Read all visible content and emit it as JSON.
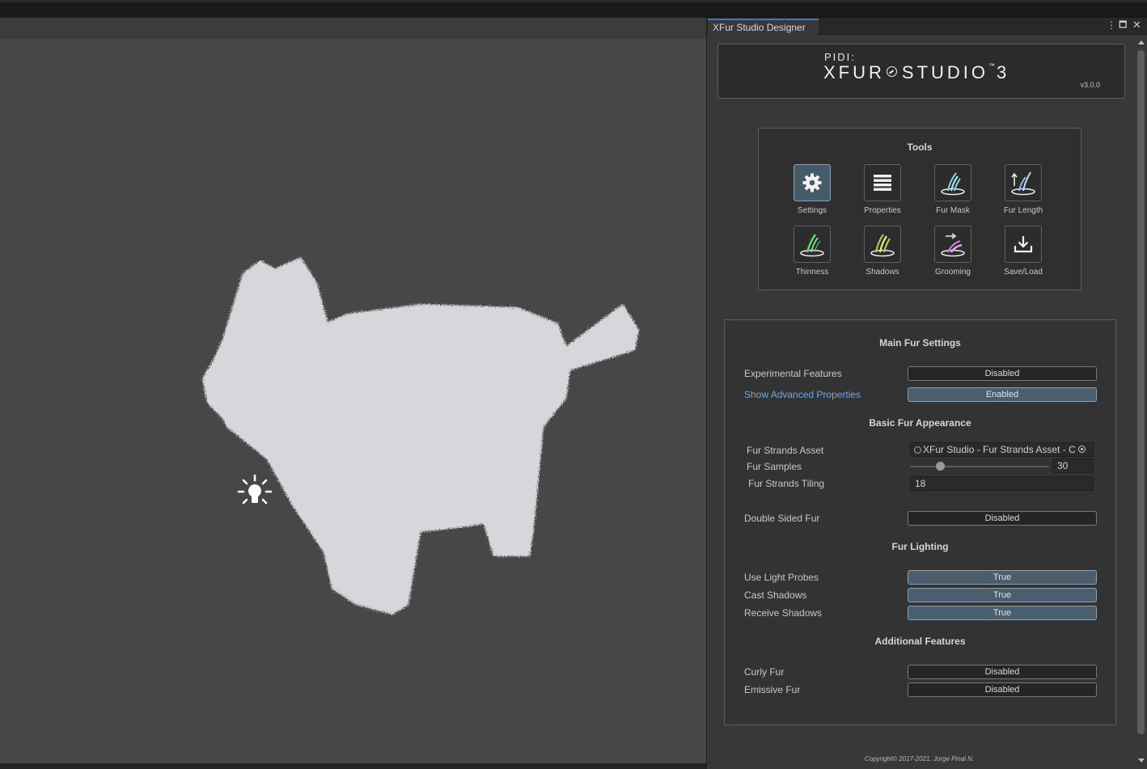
{
  "window": {
    "tab_title": "XFur Studio Designer",
    "menu_icon": "kebab-menu-icon",
    "maximize_icon": "maximize-icon",
    "close_icon": "close-icon"
  },
  "brand": {
    "company": "PIDI:",
    "product_part1": "XFUR",
    "product_part2": "STUDIO",
    "trademark": "™",
    "product_version_number": "3",
    "version": "v3.0.0"
  },
  "tools": {
    "title": "Tools",
    "items": [
      {
        "label": "Settings",
        "icon": "gear-icon",
        "active": true
      },
      {
        "label": "Properties",
        "icon": "list-icon",
        "active": false
      },
      {
        "label": "Fur Mask",
        "icon": "fur-mask-icon",
        "active": false
      },
      {
        "label": "Fur Length",
        "icon": "fur-length-icon",
        "active": false
      },
      {
        "label": "Thinness",
        "icon": "thinness-icon",
        "active": false
      },
      {
        "label": "Shadows",
        "icon": "shadows-icon",
        "active": false
      },
      {
        "label": "Grooming",
        "icon": "grooming-icon",
        "active": false
      },
      {
        "label": "Save/Load",
        "icon": "download-icon",
        "active": false
      }
    ]
  },
  "main": {
    "title": "Main Fur Settings",
    "experimental_label": "Experimental Features",
    "experimental_value": "Disabled",
    "advanced_label": "Show Advanced Properties",
    "advanced_value": "Enabled",
    "basic_title": "Basic Fur Appearance",
    "strands_asset_label": "Fur Strands Asset",
    "strands_asset_value": "XFur Studio - Fur Strands Asset - C",
    "samples_label": "Fur Samples",
    "samples_value": "30",
    "samples_fraction": 0.22,
    "tiling_label": "Fur Strands Tiling",
    "tiling_value": "18",
    "double_sided_label": "Double Sided Fur",
    "double_sided_value": "Disabled",
    "lighting_title": "Fur Lighting",
    "light_probes_label": "Use Light Probes",
    "light_probes_value": "True",
    "cast_shadows_label": "Cast Shadows",
    "cast_shadows_value": "True",
    "receive_shadows_label": "Receive Shadows",
    "receive_shadows_value": "True",
    "additional_title": "Additional Features",
    "curly_label": "Curly Fur",
    "curly_value": "Disabled",
    "emissive_label": "Emissive Fur",
    "emissive_value": "Disabled"
  },
  "footer": {
    "copyright": "Copyright© 2017-2021,   Jorge Pinal N."
  },
  "colors": {
    "accent": "#3a79bb",
    "link": "#6fa8dc",
    "toggle_on": "#4b5e6d",
    "viewport": "#474747"
  }
}
